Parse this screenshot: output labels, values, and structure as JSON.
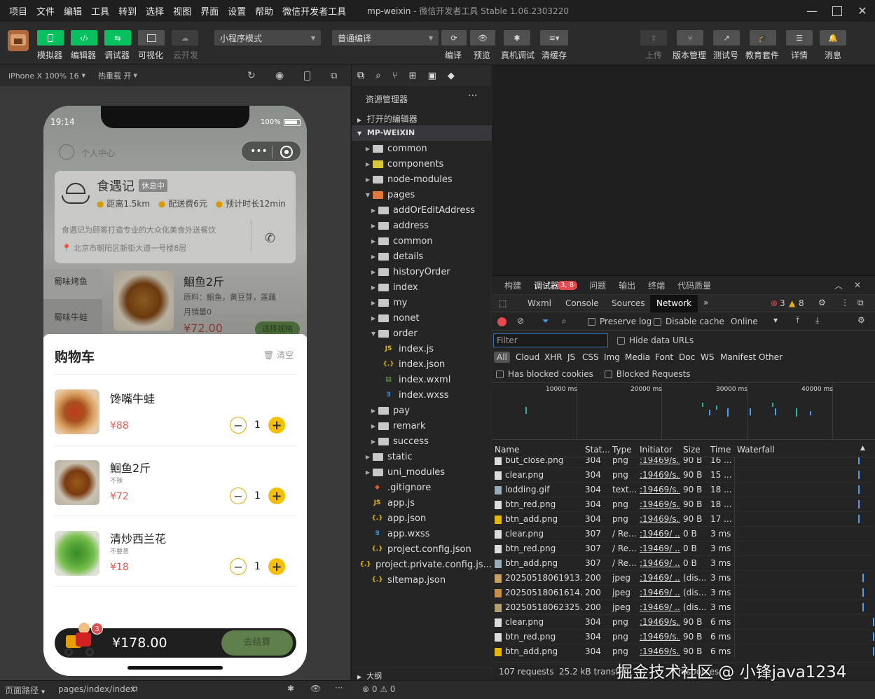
{
  "menu": {
    "items": [
      "项目",
      "文件",
      "编辑",
      "工具",
      "转到",
      "选择",
      "视图",
      "界面",
      "设置",
      "帮助",
      "微信开发者工具"
    ],
    "title_project": "mp-weixin",
    "title_rest": " - 微信开发者工具 Stable 1.06.2303220"
  },
  "toolbar": {
    "left_labels": [
      "模拟器",
      "编辑器",
      "调试器",
      "可视化",
      "云开发"
    ],
    "mode_select": "小程序模式",
    "compile_select": "普通编译",
    "mid_labels": [
      "编译",
      "预览",
      "真机调试",
      "清缓存"
    ],
    "right_labels": [
      "上传",
      "版本管理",
      "测试号",
      "教育套件",
      "详情",
      "消息"
    ]
  },
  "simbar": {
    "device": "iPhone X 100% 16",
    "hotreload": "热重载 开"
  },
  "phone": {
    "time": "19:14",
    "battery": "100%",
    "user_center": "个人中心",
    "shop_name": "食遇记",
    "shop_status": "休息中",
    "distance": "距离1.5km",
    "delivery_fee": "配送费6元",
    "eta": "预计时长12min",
    "desc": "食遇记为顾客打造专业的大众化美食外送餐饮",
    "address": "北京市朝阳区新街大道一号楼8层",
    "categories": [
      "蜀味烤鱼",
      "蜀味牛蛙"
    ],
    "dish_name": "鮰鱼2斤",
    "dish_ingredients": "原料：鮰鱼，黄豆芽，莲藕",
    "dish_sales": "月销量0",
    "dish_price": "¥72.00",
    "dish_btn": "选择规格",
    "cart_title": "购物车",
    "cart_clear": "清空",
    "cart_items": [
      {
        "name": "馋嘴牛蛙",
        "spec": "",
        "price": "¥88",
        "qty": "1"
      },
      {
        "name": "鮰鱼2斤",
        "spec": "不辣",
        "price": "¥72",
        "qty": "1"
      },
      {
        "name": "清炒西兰花",
        "spec": "不要葱",
        "price": "¥18",
        "qty": "1"
      }
    ],
    "cart_count": "3",
    "total": "¥178.00",
    "checkout": "去结算"
  },
  "explorer": {
    "title": "资源管理器",
    "open_editors": "打开的编辑器",
    "root": "MP-WEIXIN",
    "items": [
      {
        "label": "common",
        "type": "folder"
      },
      {
        "label": "components",
        "type": "folder"
      },
      {
        "label": "node-modules",
        "type": "folder"
      },
      {
        "label": "pages",
        "type": "folder"
      },
      {
        "label": "addOrEditAddress",
        "type": "folder"
      },
      {
        "label": "address",
        "type": "folder"
      },
      {
        "label": "common",
        "type": "folder"
      },
      {
        "label": "details",
        "type": "folder"
      },
      {
        "label": "historyOrder",
        "type": "folder"
      },
      {
        "label": "index",
        "type": "folder"
      },
      {
        "label": "my",
        "type": "folder"
      },
      {
        "label": "nonet",
        "type": "folder"
      },
      {
        "label": "order",
        "type": "folder"
      },
      {
        "label": "index.js",
        "type": "js"
      },
      {
        "label": "index.json",
        "type": "json"
      },
      {
        "label": "index.wxml",
        "type": "wxml"
      },
      {
        "label": "index.wxss",
        "type": "wxss"
      },
      {
        "label": "pay",
        "type": "folder"
      },
      {
        "label": "remark",
        "type": "folder"
      },
      {
        "label": "success",
        "type": "folder"
      },
      {
        "label": "static",
        "type": "folder"
      },
      {
        "label": "uni_modules",
        "type": "folder"
      },
      {
        "label": ".gitignore",
        "type": "git"
      },
      {
        "label": "app.js",
        "type": "js"
      },
      {
        "label": "app.json",
        "type": "json"
      },
      {
        "label": "app.wxss",
        "type": "wxss"
      },
      {
        "label": "project.config.json",
        "type": "json"
      },
      {
        "label": "project.private.config.js...",
        "type": "json"
      },
      {
        "label": "sitemap.json",
        "type": "json"
      }
    ],
    "outline": "大纲",
    "problems": "⊗ 0 ⚠ 0"
  },
  "devtools": {
    "top_tabs": [
      "构建",
      "调试器",
      "问题",
      "输出",
      "终端",
      "代码质量"
    ],
    "debugger_badge": "3, 8",
    "panel_tabs": [
      "Wxml",
      "Console",
      "Sources",
      "Network"
    ],
    "errors": "3",
    "warnings": "8",
    "preserve_log": "Preserve log",
    "disable_cache": "Disable cache",
    "online": "Online",
    "filter_placeholder": "Filter",
    "hide_data_urls": "Hide data URLs",
    "types": [
      "All",
      "Cloud",
      "XHR",
      "JS",
      "CSS",
      "Img",
      "Media",
      "Font",
      "Doc",
      "WS",
      "Manifest",
      "Other"
    ],
    "blocked_cookies": "Has blocked cookies",
    "blocked_requests": "Blocked Requests",
    "timeline_ticks": [
      "10000 ms",
      "20000 ms",
      "30000 ms",
      "40000 ms"
    ],
    "columns": [
      "Name",
      "Stat...",
      "Type",
      "Initiator",
      "Size",
      "Time",
      "Waterfall"
    ],
    "rows": [
      {
        "name": "but_close.png",
        "status": "304",
        "type": "png",
        "init": ":19469/s...",
        "size": "90 B",
        "time": "16 ..."
      },
      {
        "name": "clear.png",
        "status": "304",
        "type": "png",
        "init": ":19469/s...",
        "size": "90 B",
        "time": "15 ..."
      },
      {
        "name": "lodding.gif",
        "status": "304",
        "type": "text...",
        "init": ":19469/s...",
        "size": "90 B",
        "time": "18 ..."
      },
      {
        "name": "btn_red.png",
        "status": "304",
        "type": "png",
        "init": ":19469/s...",
        "size": "90 B",
        "time": "18 ..."
      },
      {
        "name": "btn_add.png",
        "status": "304",
        "type": "png",
        "init": ":19469/s...",
        "size": "90 B",
        "time": "17 ..."
      },
      {
        "name": "clear.png",
        "status": "307",
        "type": "/ Re...",
        "init": ":19469/ ...",
        "size": "0 B",
        "time": "3 ms"
      },
      {
        "name": "btn_red.png",
        "status": "307",
        "type": "/ Re...",
        "init": ":19469/ ...",
        "size": "0 B",
        "time": "3 ms"
      },
      {
        "name": "btn_add.png",
        "status": "307",
        "type": "/ Re...",
        "init": ":19469/ ...",
        "size": "0 B",
        "time": "3 ms"
      },
      {
        "name": "20250518061913...",
        "status": "200",
        "type": "jpeg",
        "init": ":19469/ ...",
        "size": "(dis...",
        "time": "3 ms"
      },
      {
        "name": "20250518061614...",
        "status": "200",
        "type": "jpeg",
        "init": ":19469/ ...",
        "size": "(dis...",
        "time": "3 ms"
      },
      {
        "name": "20250518062325...",
        "status": "200",
        "type": "jpeg",
        "init": ":19469/ ...",
        "size": "(dis...",
        "time": "3 ms"
      },
      {
        "name": "clear.png",
        "status": "304",
        "type": "png",
        "init": ":19469/s...",
        "size": "90 B",
        "time": "6 ms"
      },
      {
        "name": "btn_red.png",
        "status": "304",
        "type": "png",
        "init": ":19469/s...",
        "size": "90 B",
        "time": "6 ms"
      },
      {
        "name": "btn_add.png",
        "status": "304",
        "type": "png",
        "init": ":19469/s...",
        "size": "90 B",
        "time": "6 ms"
      }
    ],
    "requests": "107 requests",
    "transferred": "25.2 kB transfer",
    "resources": "resources"
  },
  "statusbar": {
    "path_label": "页面路径",
    "path": "pages/index/index"
  },
  "watermark": "掘金技术社区 @ 小锋java1234",
  "colors": {
    "accent": "#07c160",
    "error": "#e5484d",
    "warning": "#e5b000",
    "price": "#e8594c",
    "yellow": "#f6c000"
  }
}
